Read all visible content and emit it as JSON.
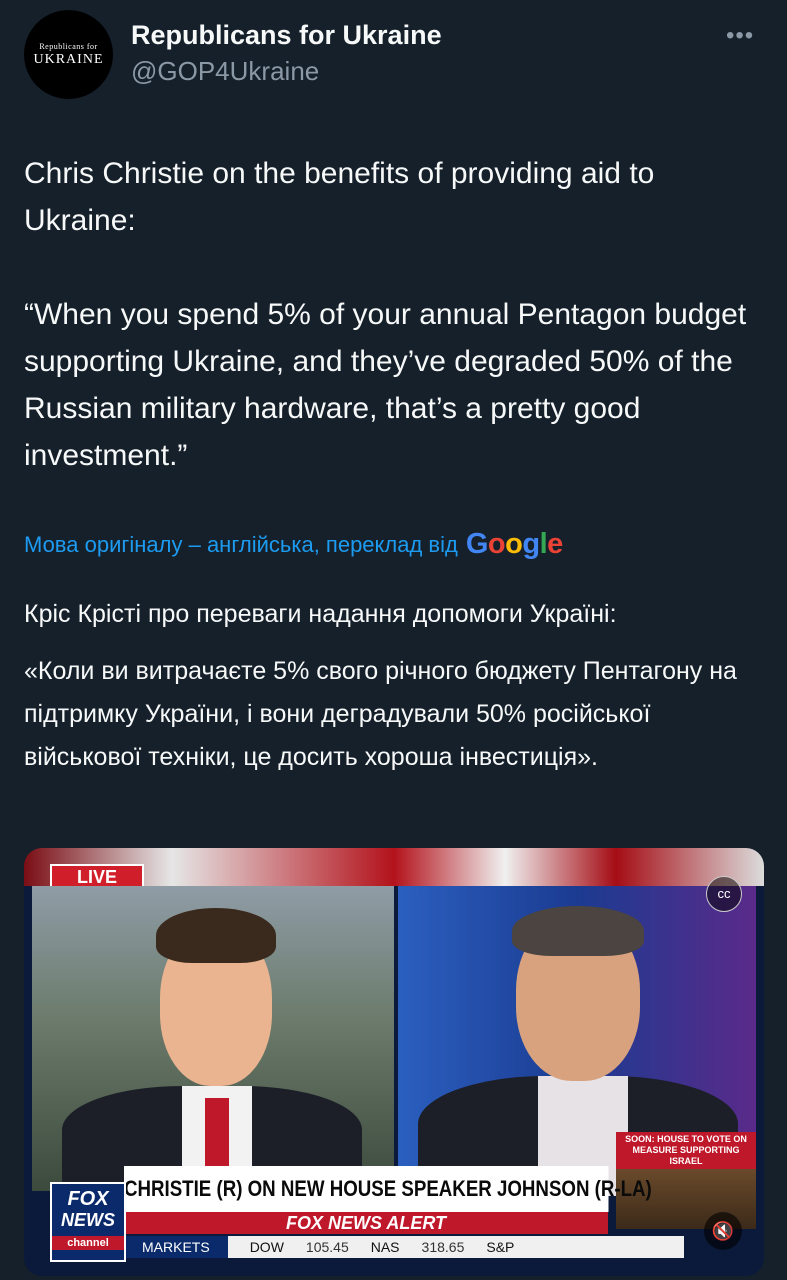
{
  "account": {
    "avatar_line1": "Republicans for",
    "avatar_line2": "UKRAINE",
    "display_name": "Republicans for Ukraine",
    "handle": "@GOP4Ukraine",
    "more_label": "•••"
  },
  "tweet": {
    "text": "Chris Christie on the benefits of providing aid to Ukraine:\n\n“When you spend 5% of your annual Pentagon budget supporting Ukraine, and they’ve degraded 50% of the Russian military hardware, that’s a pretty good investment.”"
  },
  "translation": {
    "note": "Мова оригіналу – англійська, переклад від",
    "provider_letters": [
      "G",
      "o",
      "o",
      "g",
      "l",
      "e"
    ],
    "paragraph1": "Кріс Крісті про переваги надання допомоги Україні:",
    "paragraph2": "«Коли ви витрачаєте 5% свого річного бюджету Пентагону на підтримку України, і вони деградували 50% російської військової техніки, це досить хороша інвестиція»."
  },
  "video": {
    "live_badge": "LIVE",
    "cc_icon": "cc-icon",
    "mute_icon": "mute-icon",
    "inset_label": "SOON: HOUSE TO VOTE ON MEASURE SUPPORTING ISRAEL",
    "headline": "CHRISTIE (R) ON NEW HOUSE SPEAKER JOHNSON (R-LA)",
    "alert": "FOX NEWS ALERT",
    "logo_line1": "FOX",
    "logo_line2": "NEWS",
    "logo_line3": "channel",
    "ticker": {
      "markets": "MARKETS",
      "dow_label": "DOW",
      "dow_value": "105.45",
      "nas_label": "NAS",
      "nas_value": "318.65",
      "sp_label": "S&P"
    }
  }
}
